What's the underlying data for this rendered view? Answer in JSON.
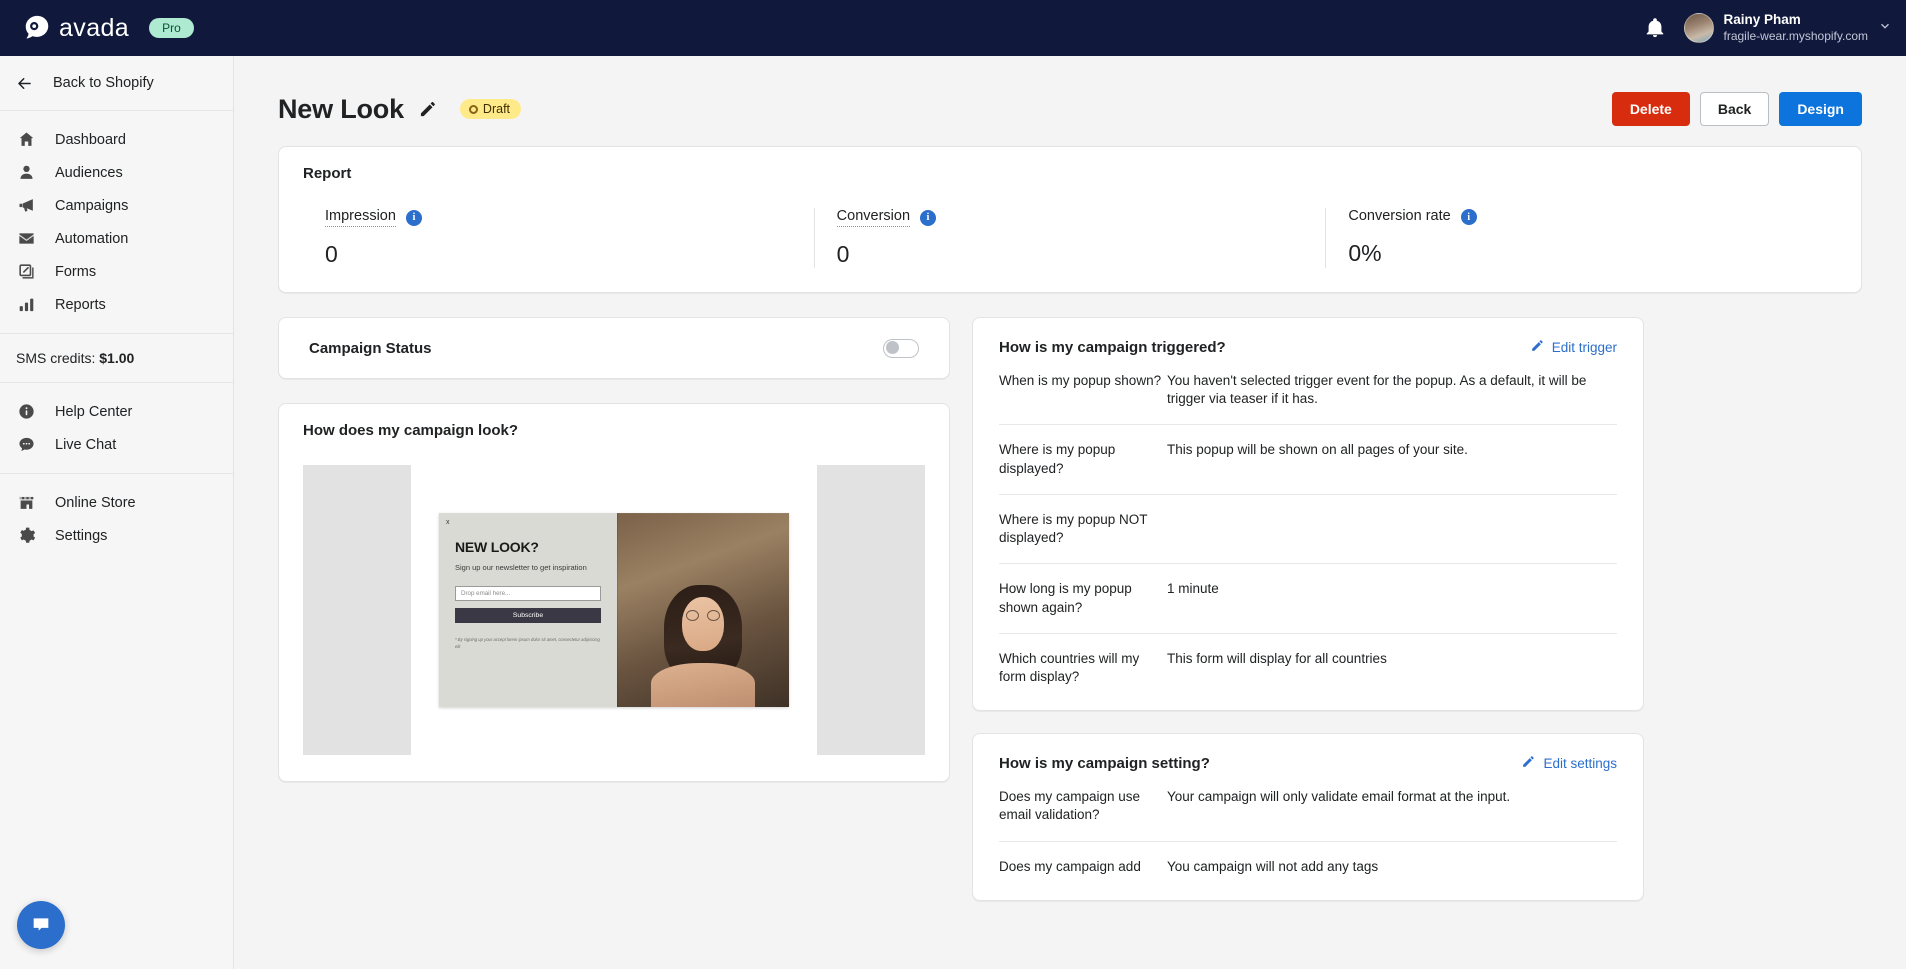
{
  "topbar": {
    "brand_name": "avada",
    "plan_badge": "Pro",
    "user_name": "Rainy Pham",
    "user_store": "fragile-wear.myshopify.com"
  },
  "sidebar": {
    "back_label": "Back to Shopify",
    "items": [
      {
        "label": "Dashboard",
        "icon": "home-icon"
      },
      {
        "label": "Audiences",
        "icon": "person-icon"
      },
      {
        "label": "Campaigns",
        "icon": "megaphone-icon"
      },
      {
        "label": "Automation",
        "icon": "envelope-icon"
      },
      {
        "label": "Forms",
        "icon": "forms-icon"
      },
      {
        "label": "Reports",
        "icon": "bar-chart-icon"
      }
    ],
    "credits_label": "SMS credits:",
    "credits_value": "$1.00",
    "support_items": [
      {
        "label": "Help Center",
        "icon": "info-icon"
      },
      {
        "label": "Live Chat",
        "icon": "chat-icon"
      }
    ],
    "store_items": [
      {
        "label": "Online Store",
        "icon": "storefront-icon"
      },
      {
        "label": "Settings",
        "icon": "gear-icon"
      }
    ]
  },
  "header": {
    "title": "New Look",
    "status_badge": "Draft",
    "delete_label": "Delete",
    "back_label": "Back",
    "design_label": "Design"
  },
  "report": {
    "title": "Report",
    "metrics": [
      {
        "label": "Impression",
        "value": "0"
      },
      {
        "label": "Conversion",
        "value": "0"
      },
      {
        "label": "Conversion rate",
        "value": "0%"
      }
    ]
  },
  "campaign_status": {
    "label": "Campaign Status",
    "enabled": false
  },
  "campaign_look": {
    "title": "How does my campaign look?",
    "popup": {
      "close_label": "x",
      "heading": "NEW LOOK?",
      "subheading": "Sign up our newsletter to get inspiration",
      "email_placeholder": "Drop email here...",
      "button_label": "Subscribe",
      "fine_print": "* By signing up your accept lorem ipsum dolor sit amet, consectetur adipiscing elit"
    }
  },
  "trigger_panel": {
    "title": "How is my campaign triggered?",
    "edit_label": "Edit trigger",
    "rows": [
      {
        "question": "When is my popup shown?",
        "answer": "You haven't selected trigger event for the popup. As a default, it will be trigger via teaser if it has."
      },
      {
        "question": "Where is my popup displayed?",
        "answer": "This popup will be shown on all pages of your site."
      },
      {
        "question": "Where is my popup NOT displayed?",
        "answer": ""
      },
      {
        "question": "How long is my popup shown again?",
        "answer": "1 minute"
      },
      {
        "question": "Which countries will my form display?",
        "answer": "This form will display for all countries"
      }
    ]
  },
  "settings_panel": {
    "title": "How is my campaign setting?",
    "edit_label": "Edit settings",
    "rows": [
      {
        "question": "Does my campaign use email validation?",
        "answer": "Your campaign will only validate email format at the input."
      },
      {
        "question": "Does my campaign add",
        "answer": "You campaign will not add any tags"
      }
    ]
  },
  "colors": {
    "topbar": "#10183C",
    "accent_blue": "#2C6ECB",
    "primary_blue": "#0C74DC",
    "danger_red": "#D72C0D",
    "draft_yellow": "#FFEA8A",
    "pro_green": "#AEE9D1"
  }
}
